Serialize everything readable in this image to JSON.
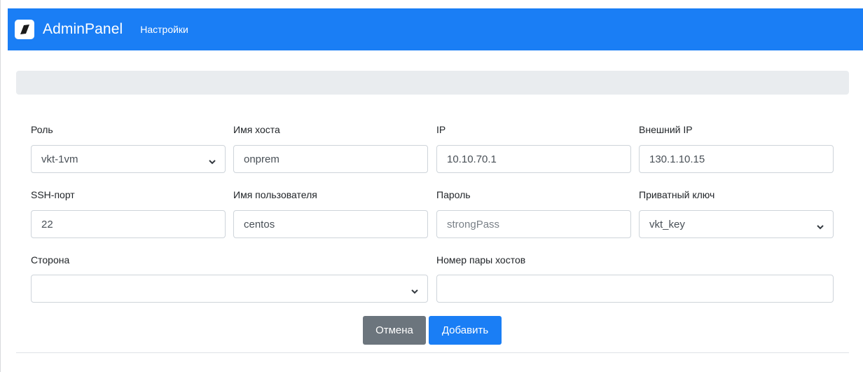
{
  "navbar": {
    "brand": "AdminPanel",
    "link_settings": "Настройки",
    "color": "#1a7ef5"
  },
  "form": {
    "role": {
      "label": "Роль",
      "value": "vkt-1vm"
    },
    "hostname": {
      "label": "Имя хоста",
      "value": "onprem"
    },
    "ip": {
      "label": "IP",
      "value": "10.10.70.1"
    },
    "external_ip": {
      "label": "Внешний IP",
      "value": "130.1.10.15"
    },
    "ssh_port": {
      "label": "SSH-порт",
      "value": "22"
    },
    "username": {
      "label": "Имя пользователя",
      "value": "centos"
    },
    "password": {
      "label": "Пароль",
      "placeholder": "strongPass"
    },
    "private_key": {
      "label": "Приватный ключ",
      "value": "vkt_key"
    },
    "side": {
      "label": "Сторона",
      "value": ""
    },
    "host_pair": {
      "label": "Номер пары хостов",
      "value": ""
    }
  },
  "actions": {
    "cancel_label": "Отмена",
    "add_label": "Добавить",
    "cancel_color": "#6c757d",
    "add_color": "#1a7ef5"
  },
  "icons": {
    "logo": "admin-logo-icon",
    "select_caret": "chevron-down-icon"
  }
}
